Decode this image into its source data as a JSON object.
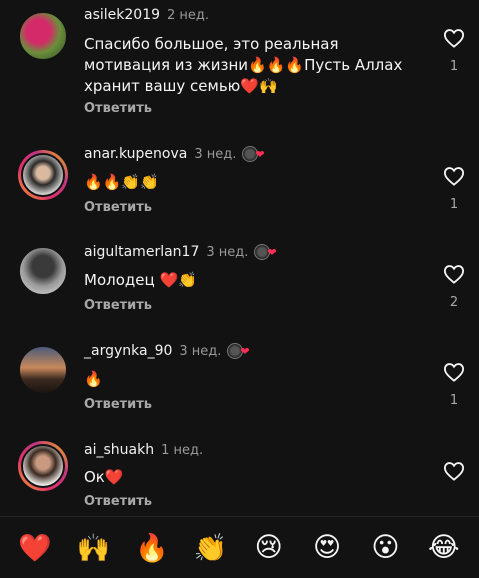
{
  "comments": [
    {
      "username": "asilek2019",
      "time": "2 нед.",
      "text": "Спасибо большое, это реальная мотивация из жизни🔥🔥🔥Пусть Аллах хранит вашу семью❤️🙌",
      "likes": "1",
      "author_liked": false
    },
    {
      "username": "anar.kupenova",
      "time": "3 нед.",
      "text": "🔥🔥👏👏",
      "likes": "1",
      "author_liked": true
    },
    {
      "username": "aigultamerlan17",
      "time": "3 нед.",
      "text": "Молодец ❤️👏",
      "likes": "2",
      "author_liked": true
    },
    {
      "username": "_argynka_90",
      "time": "3 нед.",
      "text": "🔥",
      "likes": "1",
      "author_liked": true
    },
    {
      "username": "ai_shuakh",
      "time": "1 нед.",
      "text": "Ок❤️",
      "likes": "",
      "author_liked": false
    }
  ],
  "reply_label": "Ответить",
  "author_heart": "❤",
  "quick_reactions": [
    "❤️",
    "🙌",
    "🔥",
    "👏",
    "😢",
    "😍",
    "😮",
    "😂"
  ],
  "colors": {
    "background": "#121212",
    "like_heart_author": "#ff2d55",
    "muted_text": "#a8a8a8"
  }
}
